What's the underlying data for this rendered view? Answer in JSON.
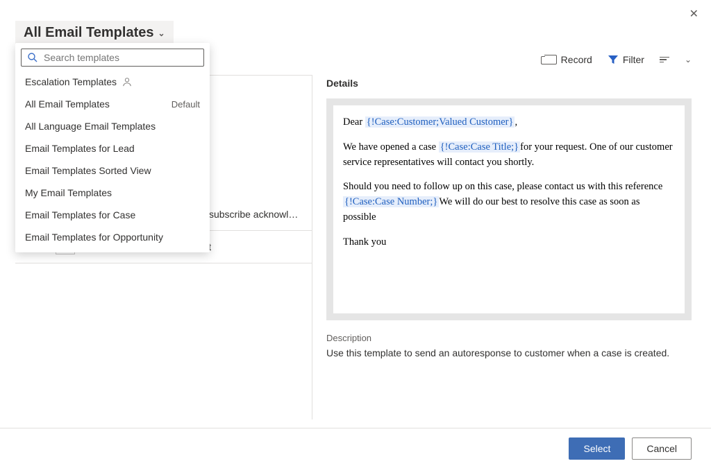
{
  "header": {
    "title": "All Email Templates"
  },
  "toolbar": {
    "record_label": "Record",
    "filter_label": "Filter"
  },
  "search": {
    "placeholder": "Search templates"
  },
  "dropdown_items": [
    {
      "label": "Escalation Templates",
      "icon": "person",
      "badge": ""
    },
    {
      "label": "All Email Templates",
      "icon": "",
      "badge": "Default"
    },
    {
      "label": "All Language Email Templates",
      "icon": "",
      "badge": ""
    },
    {
      "label": "Email Templates for Lead",
      "icon": "",
      "badge": ""
    },
    {
      "label": "Email Templates Sorted View",
      "icon": "",
      "badge": ""
    },
    {
      "label": "My Email Templates",
      "icon": "",
      "badge": ""
    },
    {
      "label": "Email Templates for Case",
      "icon": "",
      "badge": ""
    },
    {
      "label": "Email Templates for Opportunity",
      "icon": "",
      "badge": ""
    }
  ],
  "templates_list": [
    {
      "label": ""
    },
    {
      "label": ""
    },
    {
      "label": ""
    },
    {
      "label": "Marketing communication unsubscribe acknowledge…"
    },
    {
      "label": "New Case Acknowledgement"
    }
  ],
  "details": {
    "header": "Details",
    "description_label": "Description",
    "description_text": "Use this template to send an autoresponse to customer when a case is created.",
    "body": {
      "greeting_pre": "Dear ",
      "token_customer": "{!Case:Customer;Valued Customer}",
      "greeting_post": ",",
      "p2_pre": "We have opened a case ",
      "token_title": "{!Case:Case Title;}",
      "p2_post": "for your request. One of our customer service representatives will contact you shortly.",
      "p3_pre": "Should you need to follow up on this case, please contact us with this reference ",
      "token_number": "{!Case:Case Number;}",
      "p3_post": "We will do our best to resolve this case as soon as possible",
      "signoff": "Thank you"
    }
  },
  "footer": {
    "select_label": "Select",
    "cancel_label": "Cancel"
  }
}
